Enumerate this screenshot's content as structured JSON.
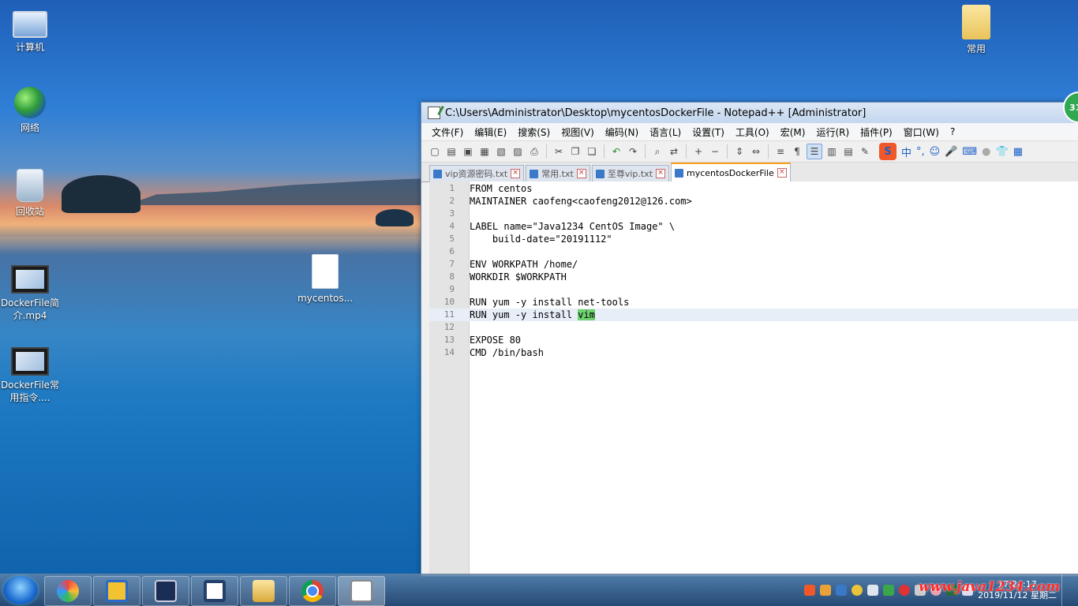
{
  "desktop": {
    "icons": [
      {
        "label": "计算机"
      },
      {
        "label": "网络"
      },
      {
        "label": "回收站"
      },
      {
        "label": "DockerFile简介.mp4"
      },
      {
        "label": "DockerFile常用指令...."
      },
      {
        "label": "mycentos..."
      },
      {
        "label": "常用"
      }
    ]
  },
  "window": {
    "title": "C:\\Users\\Administrator\\Desktop\\mycentosDockerFile - Notepad++ [Administrator]",
    "menu": [
      "文件(F)",
      "编辑(E)",
      "搜索(S)",
      "视图(V)",
      "编码(N)",
      "语言(L)",
      "设置(T)",
      "工具(O)",
      "宏(M)",
      "运行(R)",
      "插件(P)",
      "窗口(W)",
      "?"
    ],
    "ime": {
      "logo": "S",
      "mode": "中",
      "punct": "°,"
    },
    "tabs": [
      {
        "label": "vip资源密码.txt"
      },
      {
        "label": "常用.txt"
      },
      {
        "label": "至尊vip.txt"
      },
      {
        "label": "mycentosDockerFile"
      }
    ],
    "lines": [
      {
        "n": "1",
        "text": "FROM centos"
      },
      {
        "n": "2",
        "text": "MAINTAINER caofeng<caofeng2012@126.com>"
      },
      {
        "n": "3",
        "text": ""
      },
      {
        "n": "4",
        "text": "LABEL name=\"Java1234 CentOS Image\" \\"
      },
      {
        "n": "5",
        "text": "    build-date=\"20191112\""
      },
      {
        "n": "6",
        "text": ""
      },
      {
        "n": "7",
        "text": "ENV WORKPATH /home/"
      },
      {
        "n": "8",
        "text": "WORKDIR $WORKPATH"
      },
      {
        "n": "9",
        "text": ""
      },
      {
        "n": "10",
        "text": "RUN yum -y install net-tools"
      },
      {
        "n": "11",
        "text": "RUN yum -y install ",
        "highlight": "vim"
      },
      {
        "n": "12",
        "text": ""
      },
      {
        "n": "13",
        "text": "EXPOSE 80"
      },
      {
        "n": "14",
        "text": "CMD /bin/bash"
      }
    ]
  },
  "badge": "31",
  "taskbar": {
    "clock_time": "17:24:17",
    "clock_date": "2019/11/12 星期二"
  },
  "watermark": "www.java1234.com"
}
